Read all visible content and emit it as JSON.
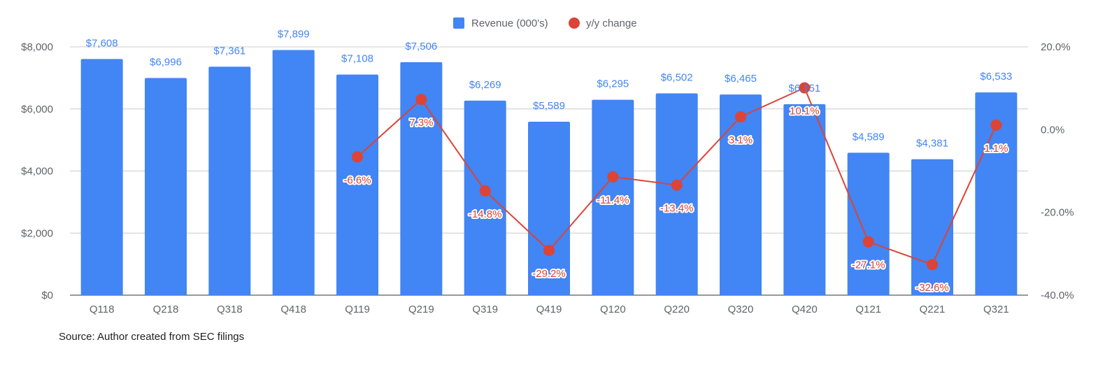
{
  "chart_data": {
    "type": "bar",
    "title": "",
    "categories": [
      "Q118",
      "Q218",
      "Q318",
      "Q418",
      "Q119",
      "Q219",
      "Q319",
      "Q419",
      "Q120",
      "Q220",
      "Q320",
      "Q420",
      "Q121",
      "Q221",
      "Q321"
    ],
    "series": [
      {
        "name": "Revenue (000's)",
        "type": "bar",
        "axis": "left",
        "color": "#4285f4",
        "values": [
          7608,
          6996,
          7361,
          7899,
          7108,
          7506,
          6269,
          5589,
          6295,
          6502,
          6465,
          6151,
          4589,
          4381,
          6533
        ],
        "labels": [
          "$7,608",
          "$6,996",
          "$7,361",
          "$7,899",
          "$7,108",
          "$7,506",
          "$6,269",
          "$5,589",
          "$6,295",
          "$6,502",
          "$6,465",
          "$6,151",
          "$4,589",
          "$4,381",
          "$6,533"
        ]
      },
      {
        "name": "y/y change",
        "type": "line",
        "axis": "right",
        "color": "#db4437",
        "values": [
          null,
          null,
          null,
          null,
          -6.6,
          7.3,
          -14.8,
          -29.2,
          -11.4,
          -13.4,
          3.1,
          10.1,
          -27.1,
          -32.6,
          1.1
        ],
        "labels": [
          null,
          null,
          null,
          null,
          "-6.6%",
          "7.3%",
          "-14.8%",
          "-29.2%",
          "-11.4%",
          "-13.4%",
          "3.1%",
          "10.1%",
          "-27.1%",
          "-32.6%",
          "1.1%"
        ]
      }
    ],
    "left_axis": {
      "range": [
        0,
        8000
      ],
      "ticks": [
        "$0",
        "$2,000",
        "$4,000",
        "$6,000",
        "$8,000"
      ]
    },
    "right_axis": {
      "range": [
        -40,
        20
      ],
      "ticks": [
        "-40.0%",
        "-20.0%",
        "0.0%",
        "20.0%"
      ]
    },
    "grid": true,
    "legend": "top-center",
    "xlabel": "",
    "ylabel": ""
  },
  "source": "Source: Author created from SEC filings"
}
